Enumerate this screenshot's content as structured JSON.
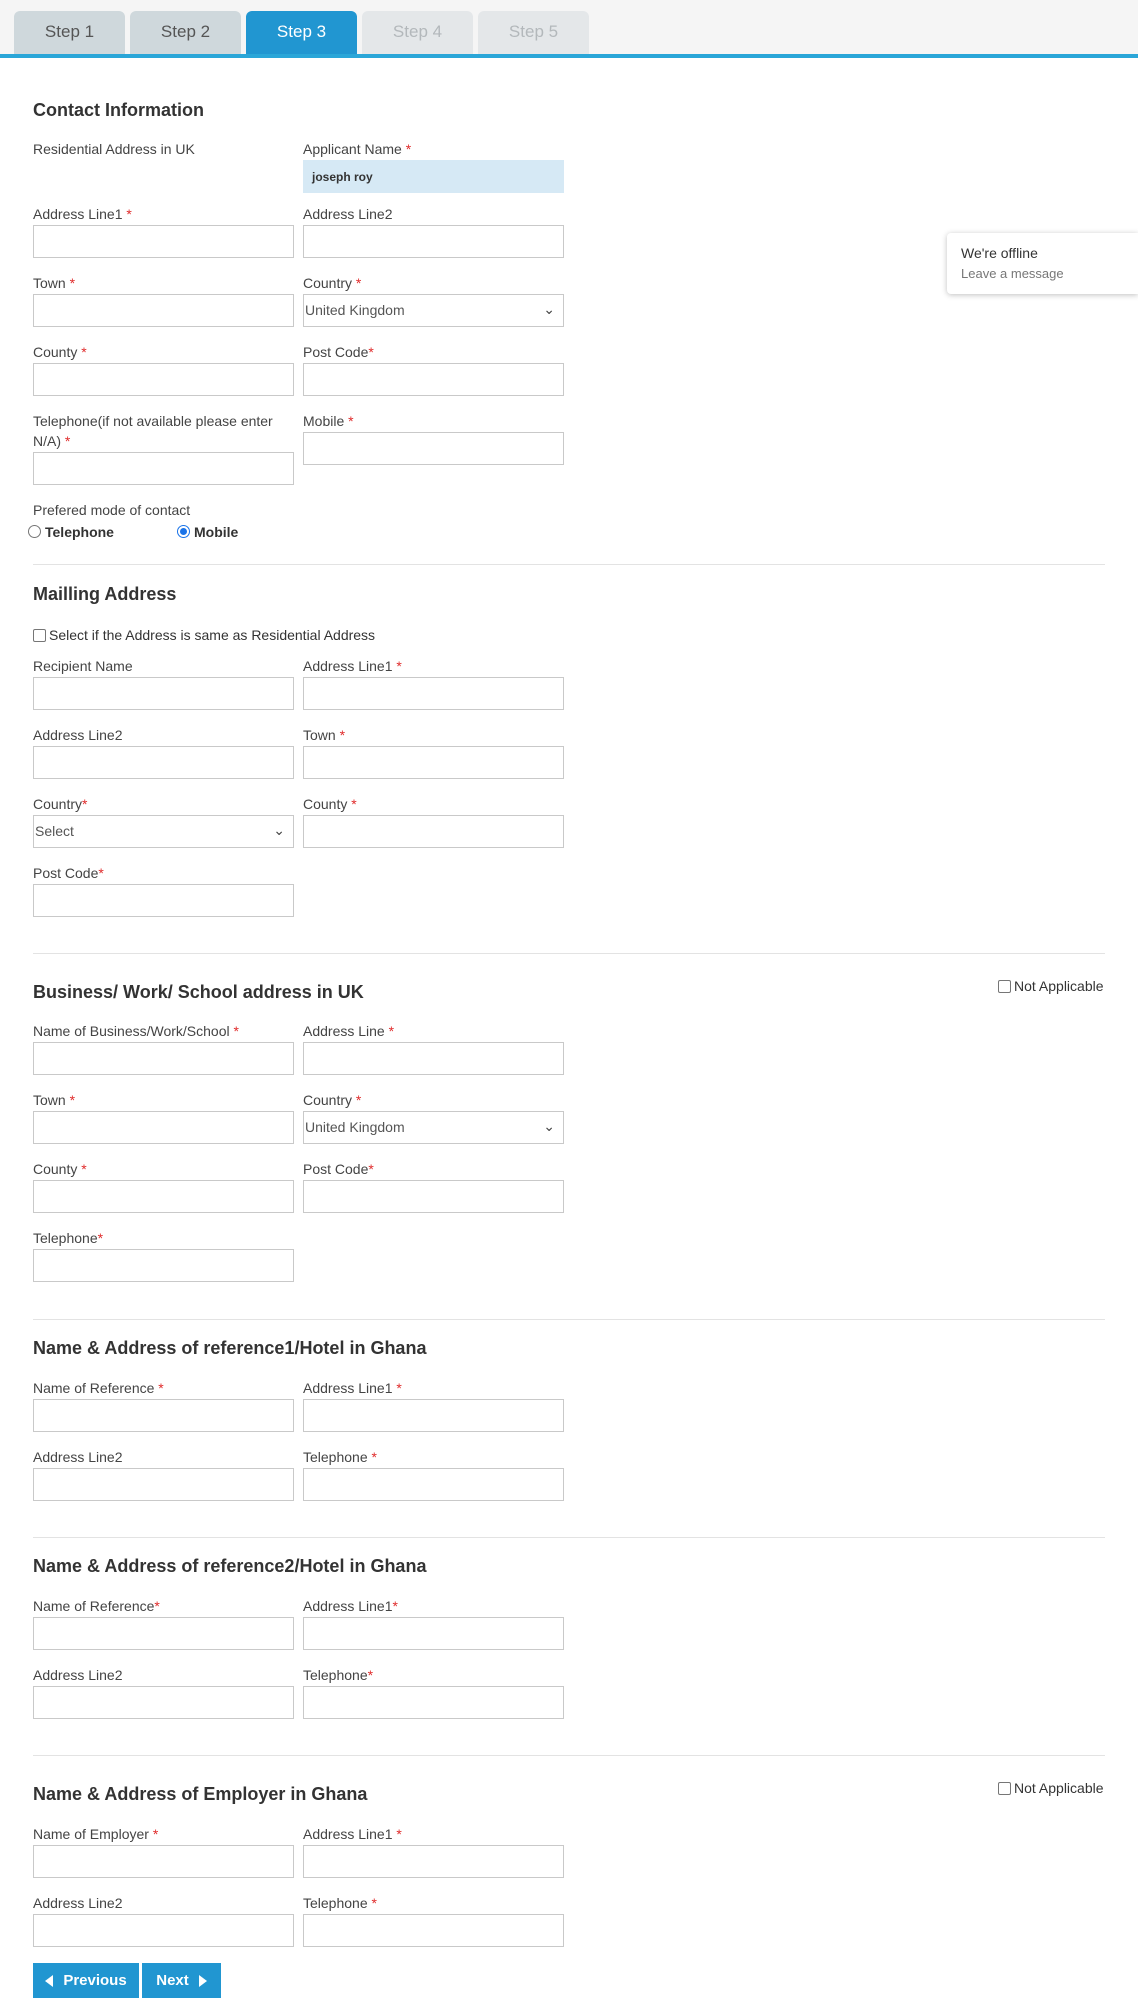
{
  "tabs": [
    "Step 1",
    "Step 2",
    "Step 3",
    "Step 4",
    "Step 5"
  ],
  "active_tab": "Step 3",
  "contact": {
    "title": "Contact Information",
    "residential_label": "Residential Address in UK",
    "applicant_name_label": "Applicant Name",
    "applicant_name_value": "joseph roy",
    "address_line1_label": "Address Line1",
    "address_line2_label": "Address Line2",
    "town_label": "Town",
    "country_label": "Country",
    "country_value": "United Kingdom",
    "county_label": "County",
    "post_code_label": "Post Code",
    "telephone_label": "Telephone(if not available please enter N/A)",
    "mobile_label": "Mobile",
    "mode_label": "Prefered mode of contact",
    "mode_telephone": "Telephone",
    "mode_mobile": "Mobile",
    "mode_selected": "Mobile"
  },
  "mailing": {
    "title": "Mailling Address",
    "same_as_label": "Select if the Address is same as Residential Address",
    "recipient_label": "Recipient Name",
    "address_line1_label": "Address Line1",
    "address_line2_label": "Address Line2",
    "town_label": "Town",
    "country_label": "Country",
    "country_value": "Select",
    "county_label": "County",
    "post_code_label": "Post Code"
  },
  "business": {
    "title": "Business/ Work/ School address in UK",
    "not_applicable": "Not Applicable",
    "name_label": "Name of Business/Work/School",
    "address_line_label": "Address Line",
    "town_label": "Town",
    "country_label": "Country",
    "country_value": "United Kingdom",
    "county_label": "County",
    "post_code_label": "Post Code",
    "telephone_label": "Telephone"
  },
  "ref1": {
    "title": "Name & Address of reference1/Hotel in Ghana",
    "name_label": "Name of Reference",
    "address_line1_label": "Address Line1",
    "address_line2_label": "Address Line2",
    "telephone_label": "Telephone"
  },
  "ref2": {
    "title": "Name & Address of reference2/Hotel in Ghana",
    "name_label": "Name of Reference",
    "address_line1_label": "Address Line1",
    "address_line2_label": "Address Line2",
    "telephone_label": "Telephone"
  },
  "employer": {
    "title": "Name & Address of Employer in Ghana",
    "not_applicable": "Not Applicable",
    "name_label": "Name of Employer",
    "address_line1_label": "Address Line1",
    "address_line2_label": "Address Line2",
    "telephone_label": "Telephone"
  },
  "chat": {
    "status": "We're offline",
    "action": "Leave a message"
  },
  "buttons": {
    "previous": "Previous",
    "next": "Next"
  },
  "required_mark": "*",
  "colors": {
    "accent": "#2196d1",
    "required": "#e02b2b",
    "prefilled_bg": "#d6e9f5"
  }
}
